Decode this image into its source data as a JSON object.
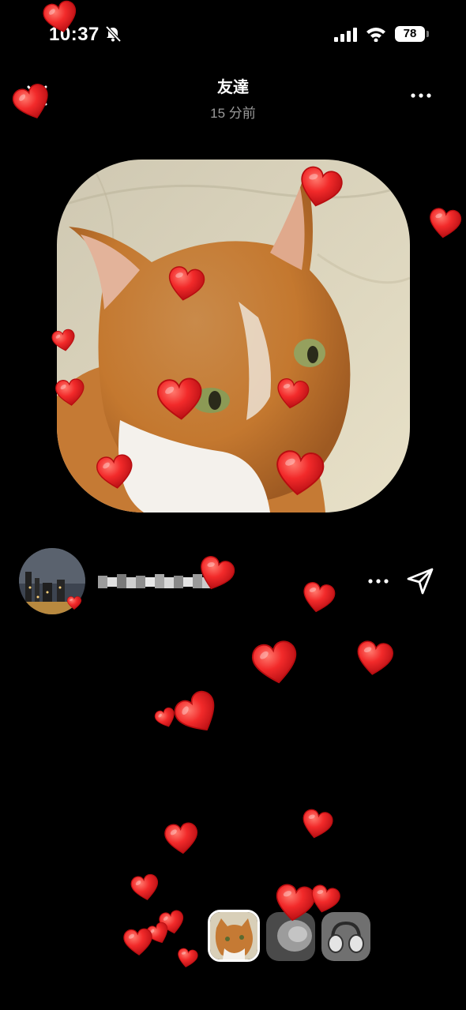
{
  "status_bar": {
    "time": "10:37",
    "battery": "78",
    "icons": [
      "bell-slash-icon",
      "signal-icon",
      "wifi-icon",
      "battery-icon"
    ]
  },
  "header": {
    "title": "友達",
    "subtitle": "15 分前",
    "close_icon": "close-icon",
    "more_icon": "more-horizontal-icon"
  },
  "post": {
    "photo": "orange-and-white-cat-photo"
  },
  "author": {
    "username_blurred": true,
    "reaction": "heart",
    "actions": [
      "more-horizontal-icon",
      "send-icon"
    ]
  },
  "thumbnails": [
    {
      "subject": "cat",
      "selected": true
    },
    {
      "subject": "blurred-gray",
      "selected": false
    },
    {
      "subject": "headphones",
      "selected": false
    }
  ],
  "colors": {
    "background": "#000000",
    "heart": "#f22a2a",
    "subtitle": "#9a9a9a"
  }
}
